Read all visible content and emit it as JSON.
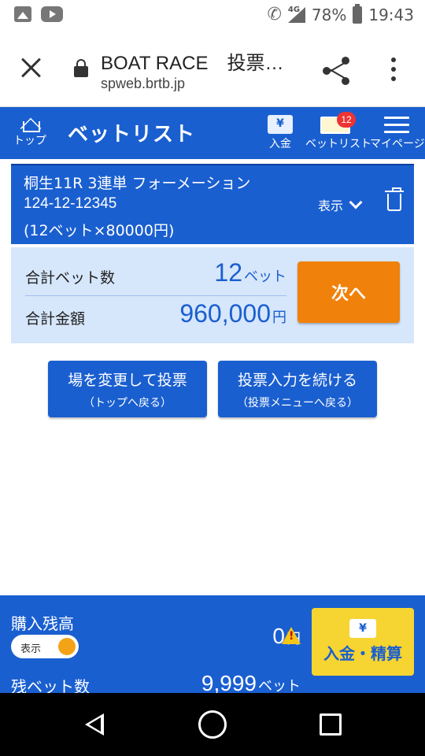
{
  "status_bar": {
    "network": "4G",
    "battery": "78%",
    "time": "19:43"
  },
  "browser": {
    "title": "BOAT RACE　投票…",
    "url": "spweb.brtb.jp"
  },
  "header": {
    "nav_top": "トップ",
    "title": "ベットリスト",
    "nav_deposit": "入金",
    "deposit_icon": "¥",
    "nav_betlist": "ベットリスト",
    "betlist_badge": "12",
    "nav_mypage": "マイページ"
  },
  "bet": {
    "line1": "桐生11R 3連単 フォーメーション",
    "line2": "124-12-12345",
    "line3": "(12ベット×80000円)",
    "show_label": "表示"
  },
  "summary": {
    "bet_count_label": "合計ベット数",
    "bet_count_value": "12",
    "bet_count_unit": "ベット",
    "total_label": "合計金額",
    "total_value": "960,000",
    "total_unit": "円",
    "next_label": "次へ"
  },
  "actions": {
    "change_main": "場を変更して投票",
    "change_sub": "（トップへ戻る）",
    "continue_main": "投票入力を続ける",
    "continue_sub": "（投票メニューへ戻る）"
  },
  "balance": {
    "label": "購入残高",
    "toggle_label": "表示",
    "value": "0",
    "unit": "円",
    "deposit_icon": "¥",
    "deposit_label": "入金・精算",
    "remaining_label": "残ベット数",
    "remaining_value": "9,999",
    "remaining_unit": "ベット"
  },
  "colors": {
    "brand_blue": "#1a5fd0",
    "next_orange": "#f0810a",
    "deposit_yellow": "#f6d431",
    "summary_bg": "#d6e6fb"
  }
}
